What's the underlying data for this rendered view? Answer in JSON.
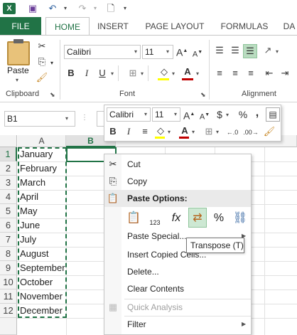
{
  "qat": {
    "logo": "X",
    "icons": [
      "save-icon",
      "undo-icon",
      "redo-icon",
      "preview-icon"
    ]
  },
  "tabs": {
    "file": "FILE",
    "items": [
      "HOME",
      "INSERT",
      "PAGE LAYOUT",
      "FORMULAS",
      "DA"
    ],
    "active": "HOME"
  },
  "ribbon": {
    "paste_label": "Paste",
    "font_name": "Calibri",
    "font_size": "11",
    "groups": {
      "clipboard": "Clipboard",
      "font": "Font",
      "alignment": "Alignment"
    },
    "bold": "B",
    "italic": "I",
    "underline": "U",
    "grow": "A",
    "shrink": "A",
    "font_color": "A"
  },
  "formula_bar": {
    "name_box": "B1"
  },
  "columns": [
    "A",
    "B"
  ],
  "rows": [
    "1",
    "2",
    "3",
    "4",
    "5",
    "6",
    "7",
    "8",
    "9",
    "10",
    "11",
    "12"
  ],
  "cells_a": [
    "January",
    "February",
    "March",
    "April",
    "May",
    "June",
    "July",
    "August",
    "September",
    "October",
    "November",
    "December"
  ],
  "mini_toolbar": {
    "font_name": "Calibri",
    "font_size": "11",
    "bold": "B",
    "italic": "I",
    "currency": "$",
    "percent": "%",
    "comma": ","
  },
  "context_menu": {
    "cut": "Cut",
    "copy": "Copy",
    "paste_options": "Paste Options:",
    "paste_special": "Paste Special...",
    "insert_copied": "Insert Copied Cells...",
    "delete": "Delete...",
    "clear": "Clear Contents",
    "quick_analysis": "Quick Analysis",
    "filter": "Filter"
  },
  "tooltip": "Transpose (T)",
  "colors": {
    "accent": "#217346",
    "selection": "#217346"
  }
}
